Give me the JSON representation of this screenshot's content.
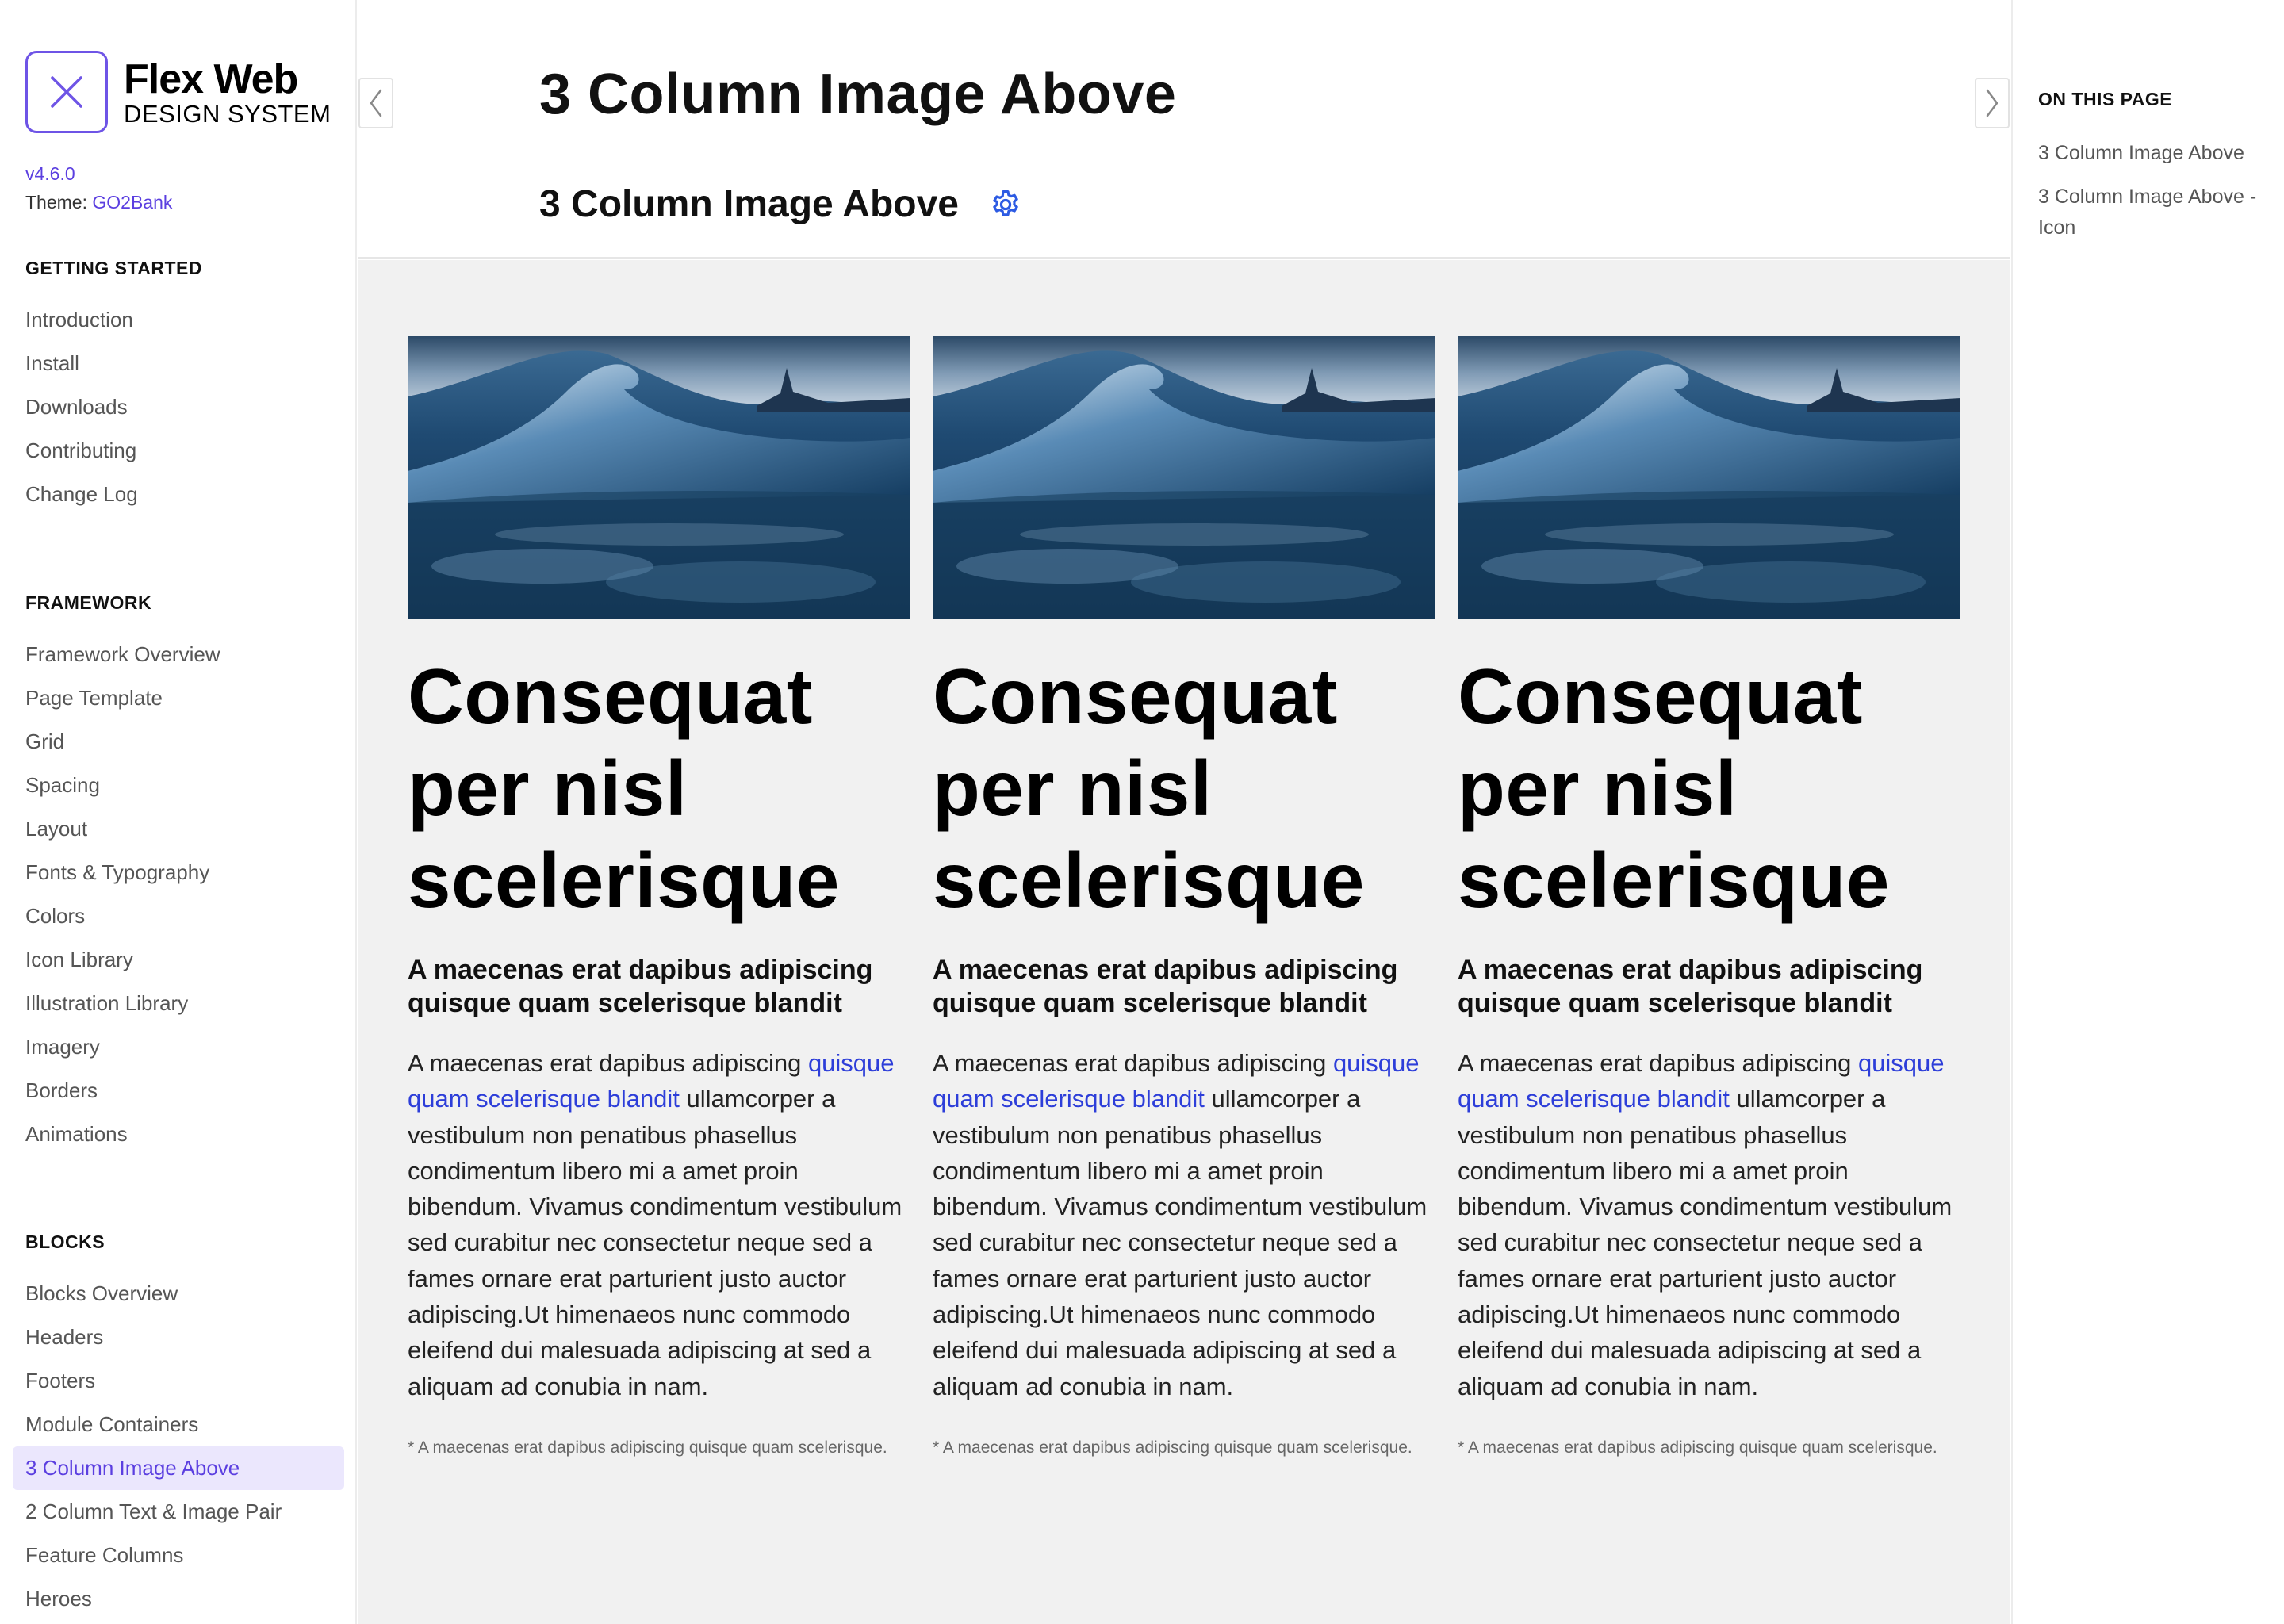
{
  "brand": {
    "name": "Flex Web",
    "subtitle": "DESIGN SYSTEM",
    "logo_icon": "close-x-icon",
    "version": "v4.6.0",
    "theme_label": "Theme:",
    "theme_value": "GO2Bank"
  },
  "sidebar": {
    "sections": [
      {
        "title": "GETTING STARTED",
        "items": [
          "Introduction",
          "Install",
          "Downloads",
          "Contributing",
          "Change Log"
        ]
      },
      {
        "title": "FRAMEWORK",
        "items": [
          "Framework Overview",
          "Page Template",
          "Grid",
          "Spacing",
          "Layout",
          "Fonts & Typography",
          "Colors",
          "Icon Library",
          "Illustration Library",
          "Imagery",
          "Borders",
          "Animations"
        ]
      },
      {
        "title": "BLOCKS",
        "items": [
          "Blocks Overview",
          "Headers",
          "Footers",
          "Module Containers",
          "3 Column Image Above",
          "2 Column Text & Image Pair",
          "Feature Columns",
          "Heroes"
        ]
      }
    ],
    "active_item": "3 Column Image Above"
  },
  "header": {
    "page_title": "3 Column Image Above",
    "section_title": "3 Column Image Above",
    "settings_icon": "gear-icon",
    "prev_icon": "chevron-left-icon",
    "next_icon": "chevron-right-icon"
  },
  "cards": [
    {
      "image": "ocean-wave-image",
      "title": "Consequat per nisl scelerisque",
      "subtitle": "A maecenas erat dapibus adipiscing quisque quam scelerisque blandit",
      "body_before": "A maecenas erat dapibus adipiscing ",
      "body_link": "quisque quam scelerisque blandit",
      "body_after": " ullamcorper a vestibulum non penatibus phasellus condimentum libero mi a amet proin bibendum. Vivamus condimentum vestibulum sed curabitur nec consectetur neque sed a fames ornare erat parturient justo auctor adipiscing.Ut himenaeos nunc commodo eleifend dui malesuada adipiscing at sed a aliquam ad conubia in nam.",
      "footnote": "* A maecenas erat dapibus adipiscing quisque quam scelerisque."
    },
    {
      "image": "ocean-wave-image",
      "title": "Consequat per nisl scelerisque",
      "subtitle": "A maecenas erat dapibus adipiscing quisque quam scelerisque blandit",
      "body_before": "A maecenas erat dapibus adipiscing ",
      "body_link": "quisque quam scelerisque blandit",
      "body_after": " ullamcorper a vestibulum non penatibus phasellus condimentum libero mi a amet proin bibendum. Vivamus condimentum vestibulum sed curabitur nec consectetur neque sed a fames ornare erat parturient justo auctor adipiscing.Ut himenaeos nunc commodo eleifend dui malesuada adipiscing at sed a aliquam ad conubia in nam.",
      "footnote": "* A maecenas erat dapibus adipiscing quisque quam scelerisque."
    },
    {
      "image": "ocean-wave-image",
      "title": "Consequat per nisl scelerisque",
      "subtitle": "A maecenas erat dapibus adipiscing quisque quam scelerisque blandit",
      "body_before": "A maecenas erat dapibus adipiscing ",
      "body_link": "quisque quam scelerisque blandit",
      "body_after": " ullamcorper a vestibulum non penatibus phasellus condimentum libero mi a amet proin bibendum. Vivamus condimentum vestibulum sed curabitur nec consectetur neque sed a fames ornare erat parturient justo auctor adipiscing.Ut himenaeos nunc commodo eleifend dui malesuada adipiscing at sed a aliquam ad conubia in nam.",
      "footnote": "* A maecenas erat dapibus adipiscing quisque quam scelerisque."
    }
  ],
  "toc": {
    "title": "ON THIS PAGE",
    "items": [
      "3 Column Image Above",
      "3 Column Image Above - Icon"
    ]
  },
  "colors": {
    "accent": "#5b3fe0",
    "link": "#2d3ed9",
    "active_bg": "#ebe7fd",
    "demo_bg": "#f1f1f1",
    "settings_icon": "#2d5be3"
  }
}
